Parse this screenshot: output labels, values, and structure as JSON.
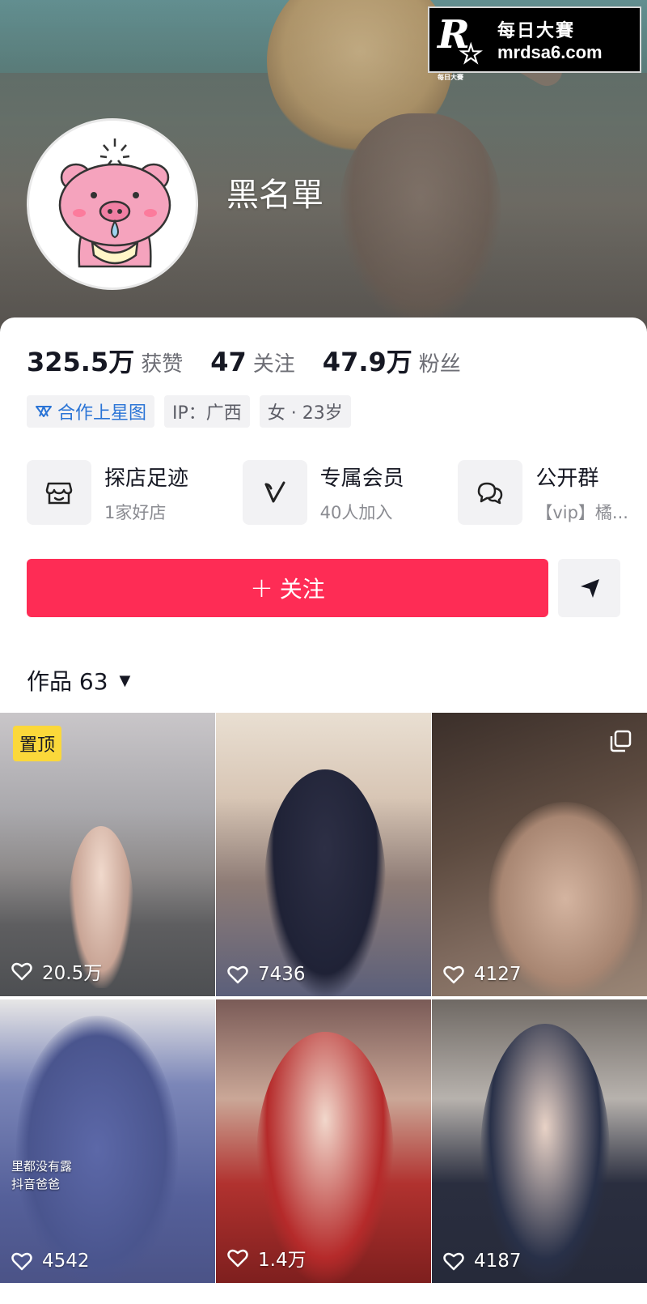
{
  "watermark": {
    "logo_letter": "R",
    "logo_mini": "每日大賽",
    "cn": "每日大賽",
    "url": "mrdsa6.com"
  },
  "profile": {
    "nickname": "黑名單"
  },
  "stats": [
    {
      "value": "325.5万",
      "label": "获赞"
    },
    {
      "value": "47",
      "label": "关注"
    },
    {
      "value": "47.9万",
      "label": "粉丝"
    }
  ],
  "tags": [
    {
      "label": "合作上星图",
      "icon": "star-map-icon"
    },
    {
      "label": "IP：广西"
    },
    {
      "label": "女 · 23岁"
    }
  ],
  "services": [
    {
      "title": "探店足迹",
      "subtitle": "1家好店",
      "icon": "shop-icon"
    },
    {
      "title": "专属会员",
      "subtitle": "40人加入",
      "icon": "vip-icon"
    },
    {
      "title": "公开群",
      "subtitle": "【vip】橘...",
      "icon": "chat-group-icon"
    }
  ],
  "actions": {
    "follow_plus": "+",
    "follow_label": "关注",
    "share_icon": "send-icon"
  },
  "works": {
    "label": "作品 63",
    "caret": "▼"
  },
  "grid": [
    {
      "likes": "20.5万",
      "pinned": "置顶"
    },
    {
      "likes": "7436"
    },
    {
      "likes": "4127",
      "multi": true
    },
    {
      "likes": "4542",
      "overlay": "里都没有露\n抖音爸爸"
    },
    {
      "likes": "1.4万"
    },
    {
      "likes": "4187"
    }
  ],
  "colors": {
    "accent": "#fe2c55",
    "pin": "#fbd83a",
    "star_link": "#2a74d6"
  }
}
